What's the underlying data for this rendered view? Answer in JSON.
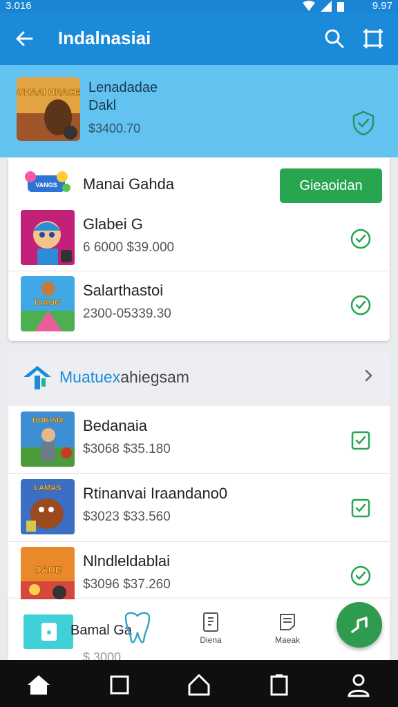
{
  "status_bar": {
    "time": "3.016",
    "battery": "9.97"
  },
  "app_bar": {
    "title": "Indalnasiai"
  },
  "featured": {
    "title_line1": "Lenadadae",
    "title_line2": "Dakl",
    "price": "$3400.70",
    "thumb_text": "GUHAAI HRACES"
  },
  "card1": {
    "header_title": "Manai Gahda",
    "header_button": "Gieaoidan",
    "header_logo_text": "VANGS",
    "items": [
      {
        "name": "Glabei G",
        "price": "6 6000 $39.000"
      },
      {
        "name": "Salarthastoi",
        "price": "2300-05339.30",
        "thumb_text": "DIANG"
      }
    ]
  },
  "section": {
    "brand": "Muatuex",
    "rest": "ahiegsam"
  },
  "card2": {
    "items": [
      {
        "name": "Bedanaia",
        "price": "$3068 $35.180",
        "thumb_text": "DOKIAM"
      },
      {
        "name": "Rtinanvai Iraandano0",
        "price": "$3023 $33.560",
        "thumb_text": "LAMAS"
      },
      {
        "name": "Nlndleldablai",
        "price": "$3096 $37.260",
        "thumb_text": "OAUE"
      }
    ]
  },
  "bottom_sheet": {
    "name": "Bamal Ga",
    "price": "$ 3000",
    "tabs": [
      {
        "label": "Diena"
      },
      {
        "label": "Maeak"
      }
    ]
  },
  "colors": {
    "primary": "#1a8ad9",
    "featured_bg": "#62c3f0",
    "success": "#27a54f",
    "fab": "#2e9b4e"
  }
}
